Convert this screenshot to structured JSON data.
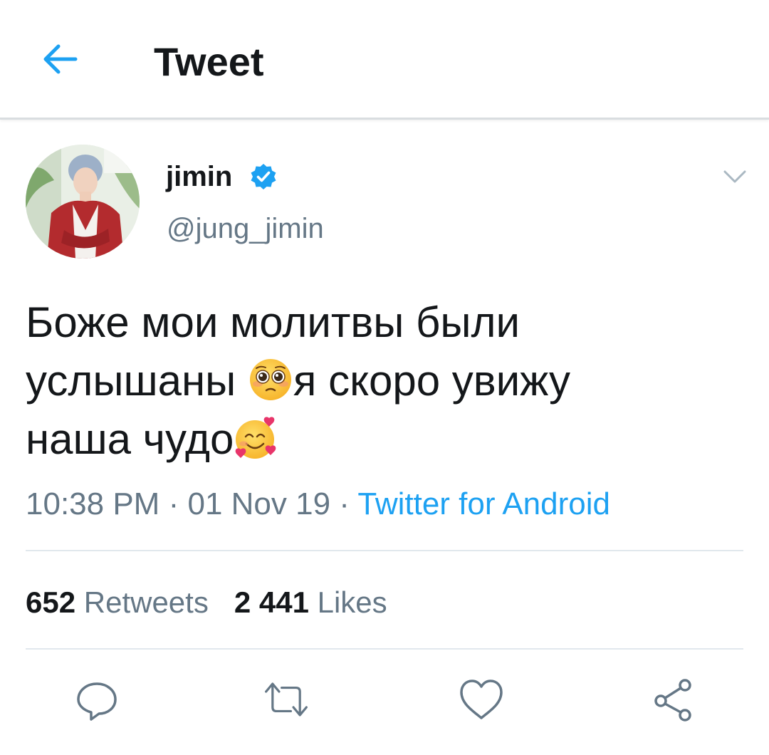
{
  "header": {
    "title": "Tweet",
    "back_icon": "arrow-left-icon"
  },
  "tweet": {
    "author": {
      "display_name": "jimin",
      "handle": "@jung_jimin",
      "verified": true
    },
    "text_line1": "Боже мои молитвы были",
    "text_line2a": "услышаны",
    "text_line2b": "я скоро увижу",
    "text_line3": "наша чудо",
    "emoji_1": "pleading-face-emoji",
    "emoji_2": "smiling-face-with-hearts-emoji",
    "time": "10:38 PM",
    "date": "01 Nov 19",
    "separator": "·",
    "source": "Twitter for Android",
    "retweets_count": "652",
    "retweets_label": "Retweets",
    "likes_count": "2 441",
    "likes_label": "Likes"
  },
  "actions": [
    "reply-icon",
    "retweet-icon",
    "like-icon",
    "share-icon"
  ],
  "colors": {
    "accent": "#1da1f2",
    "text": "#14171a",
    "secondary": "#657786",
    "divider": "#e1e8ed"
  }
}
